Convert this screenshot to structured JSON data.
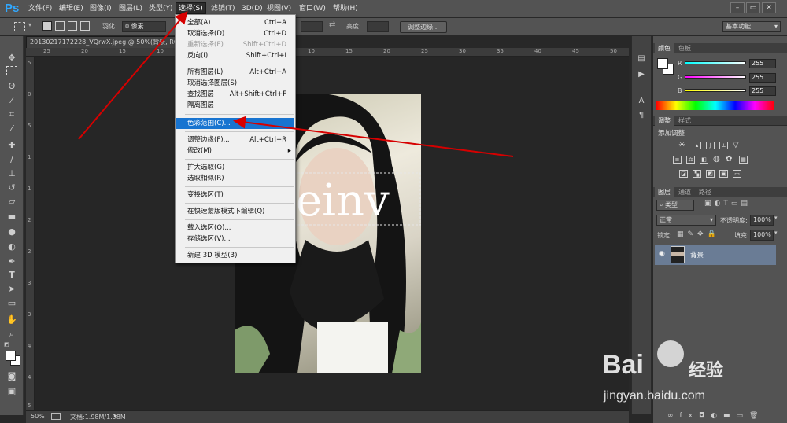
{
  "app": {
    "logo": "Ps"
  },
  "menu": [
    {
      "label": "文件(F)"
    },
    {
      "label": "编辑(E)"
    },
    {
      "label": "图像(I)"
    },
    {
      "label": "图层(L)"
    },
    {
      "label": "类型(Y)"
    },
    {
      "label": "选择(S)"
    },
    {
      "label": "滤镜(T)"
    },
    {
      "label": "3D(D)"
    },
    {
      "label": "视图(V)"
    },
    {
      "label": "窗口(W)"
    },
    {
      "label": "帮助(H)"
    }
  ],
  "window_controls": {
    "minimize": "–",
    "restore": "▭",
    "close": "✕"
  },
  "options": {
    "feather_label": "羽化:",
    "feather_value": "0 像素",
    "height_label": "高度:",
    "refine_button": "调整边缘...",
    "workspace": "基本功能"
  },
  "document": {
    "tab_title": "20130217172228_VQrwX.jpeg @ 50%(背景, RGB/8)",
    "zoom": "50%",
    "doc_size": "文档:1.98M/1.98M",
    "image_overlay_text": "einv"
  },
  "ruler": {
    "top": [
      "25",
      "20",
      "15",
      "10",
      "5",
      "0",
      "5",
      "10",
      "15",
      "20",
      "25",
      "30",
      "35",
      "40",
      "45",
      "50"
    ],
    "left": [
      "5",
      "0",
      "5",
      "1",
      "1",
      "2",
      "2",
      "3",
      "3",
      "4",
      "4",
      "5"
    ]
  },
  "select_menu": {
    "items": [
      {
        "label": "全部(A)",
        "shortcut": "Ctrl+A"
      },
      {
        "label": "取消选择(D)",
        "shortcut": "Ctrl+D"
      },
      {
        "label": "重新选择(E)",
        "shortcut": "Shift+Ctrl+D",
        "disabled": true
      },
      {
        "label": "反向(I)",
        "shortcut": "Shift+Ctrl+I"
      },
      {
        "label": "所有图层(L)",
        "shortcut": "Alt+Ctrl+A"
      },
      {
        "label": "取消选择图层(S)",
        "shortcut": ""
      },
      {
        "label": "查找图层",
        "shortcut": "Alt+Shift+Ctrl+F"
      },
      {
        "label": "隔离图层",
        "shortcut": ""
      },
      {
        "label": "色彩范围(C)...",
        "shortcut": "",
        "highlighted": true
      },
      {
        "label": "调整边缘(F)...",
        "shortcut": "Alt+Ctrl+R"
      },
      {
        "label": "修改(M)",
        "shortcut": "▸"
      },
      {
        "label": "扩大选取(G)",
        "shortcut": ""
      },
      {
        "label": "选取相似(R)",
        "shortcut": ""
      },
      {
        "label": "变换选区(T)",
        "shortcut": ""
      },
      {
        "label": "在快速蒙版模式下编辑(Q)",
        "shortcut": ""
      },
      {
        "label": "载入选区(O)...",
        "shortcut": ""
      },
      {
        "label": "存储选区(V)...",
        "shortcut": ""
      },
      {
        "label": "新建 3D 模型(3)",
        "shortcut": ""
      }
    ]
  },
  "color_panel": {
    "tabs": [
      "颜色",
      "色板"
    ],
    "channels": [
      {
        "name": "R",
        "value": "255"
      },
      {
        "name": "G",
        "value": "255"
      },
      {
        "name": "B",
        "value": "255"
      }
    ]
  },
  "adjust_panel": {
    "tabs": [
      "调整",
      "样式"
    ],
    "title": "添加调整"
  },
  "layers_panel": {
    "tabs": [
      "图层",
      "通道",
      "路径"
    ],
    "filter": "类型",
    "blend_mode": "正常",
    "opacity_label": "不透明度:",
    "opacity": "100%",
    "lock_label": "锁定:",
    "fill_label": "填充:",
    "fill": "100%",
    "layers": [
      {
        "name": "背景"
      }
    ]
  },
  "watermark": {
    "brand": "Bai",
    "brand_suffix": "经验",
    "url": "jingyan.baidu.com"
  },
  "colors": {
    "highlight": "#1874d0",
    "layer_selected": "#6a7c95",
    "arrow": "#d60000"
  }
}
